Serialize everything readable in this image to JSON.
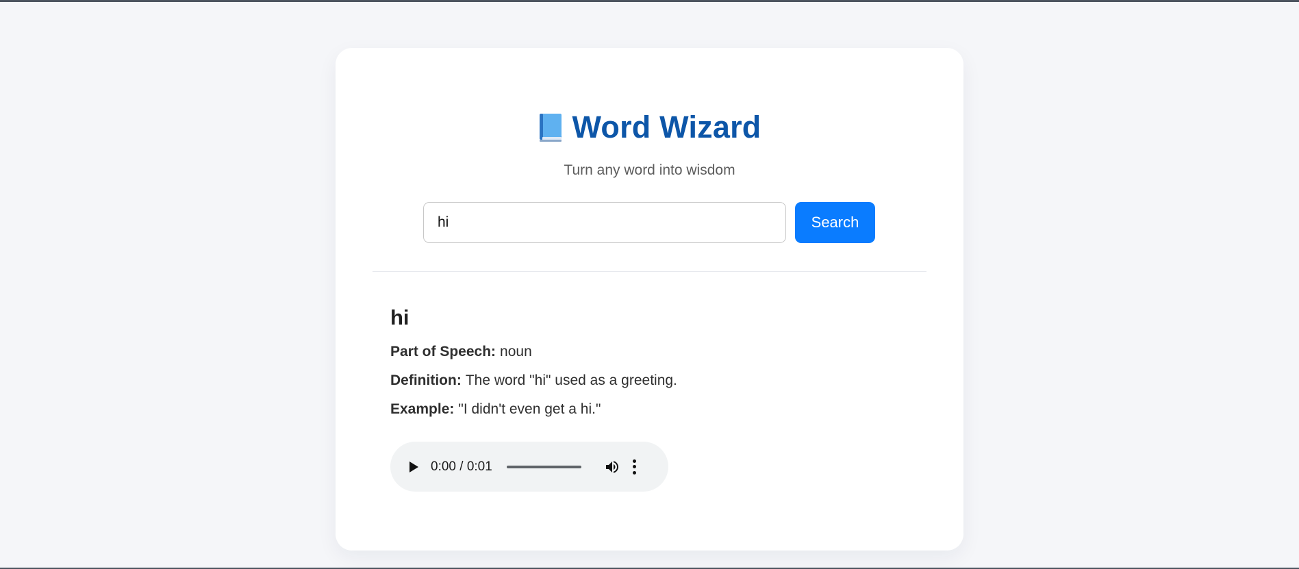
{
  "app": {
    "title": "Word Wizard",
    "subtitle": "Turn any word into wisdom",
    "icon": "blue-book-icon"
  },
  "search": {
    "value": "hi",
    "button_label": "Search"
  },
  "result": {
    "word": "hi",
    "part_of_speech_label": "Part of Speech:",
    "part_of_speech": "noun",
    "definition_label": "Definition:",
    "definition": "The word \"hi\" used as a greeting.",
    "example_label": "Example:",
    "example": "\"I didn't even get a hi.\""
  },
  "audio": {
    "time": "0:00 / 0:01",
    "progress": 0,
    "icons": [
      "play-icon",
      "volume-icon",
      "more-options-icon"
    ]
  },
  "colors": {
    "title": "#0d56a8",
    "button": "#0a7cff",
    "page_background": "#f5f6f9",
    "card_background": "#ffffff"
  }
}
